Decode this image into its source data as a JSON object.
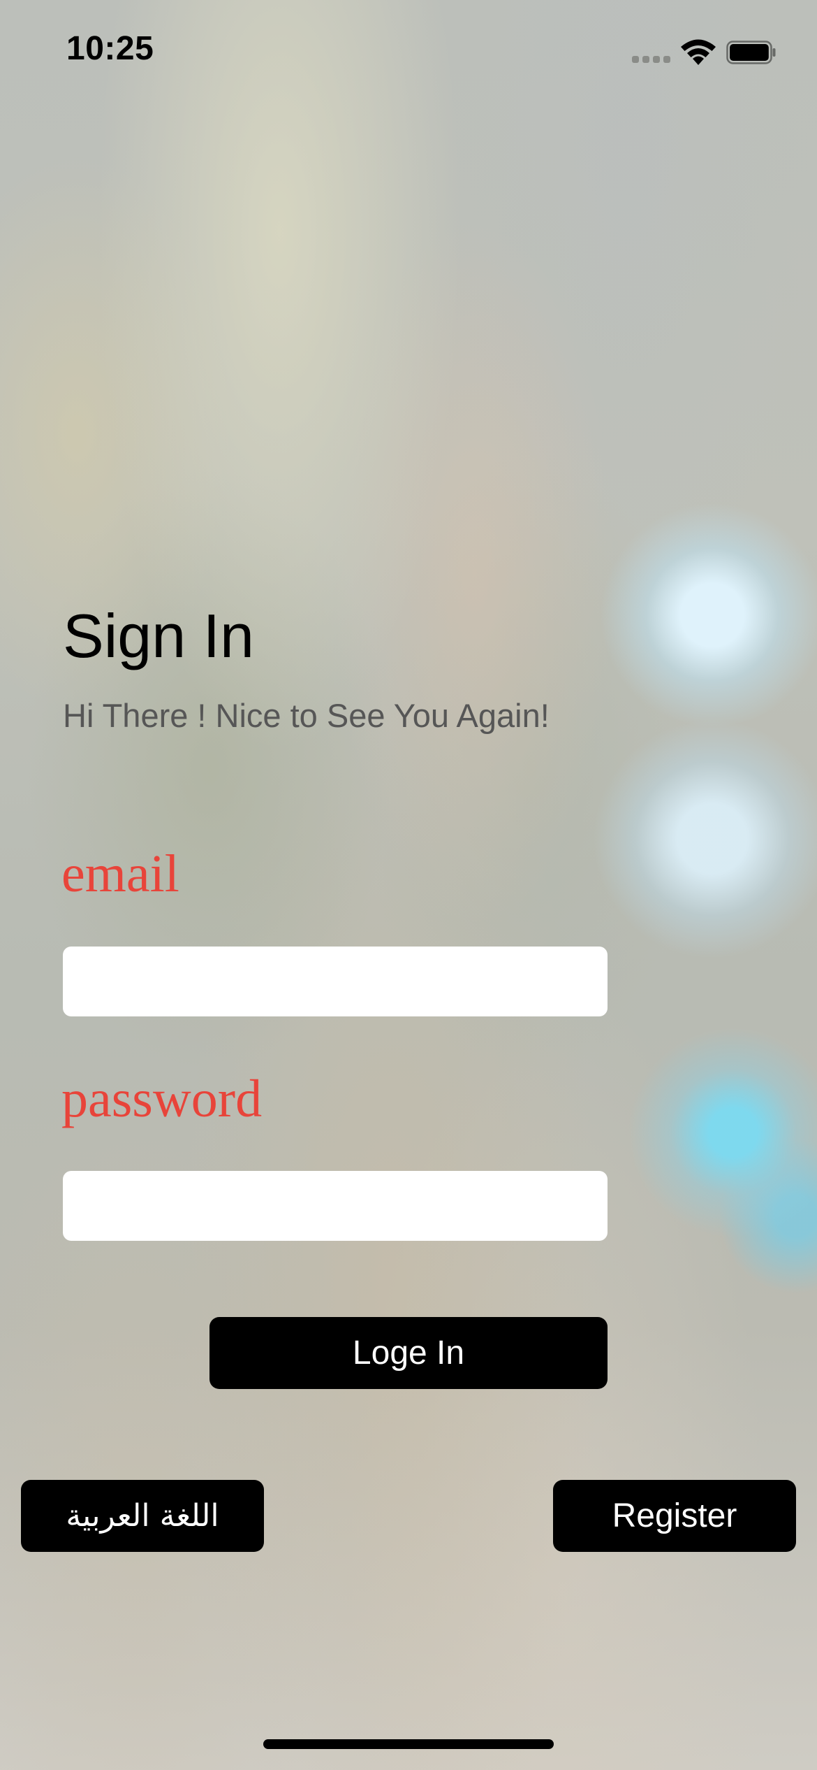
{
  "status_bar": {
    "time": "10:25",
    "signal_icon": "cellular-signal-icon",
    "wifi_icon": "wifi-icon",
    "battery_icon": "battery-icon",
    "battery_level": 0.9
  },
  "sign_in": {
    "title": "Sign In",
    "subtitle": "Hi There ! Nice to See You Again!",
    "email_label": "email",
    "email_value": "",
    "password_label": "password",
    "password_value": "",
    "login_button": "Loge In"
  },
  "footer": {
    "arabic_button": "اللغة العربية",
    "register_button": "Register"
  },
  "colors": {
    "label_color": "#e8443a",
    "button_bg": "#000000",
    "button_text": "#ffffff",
    "subtitle_color": "#565656",
    "accent_bokeh": "#78dcf5"
  }
}
